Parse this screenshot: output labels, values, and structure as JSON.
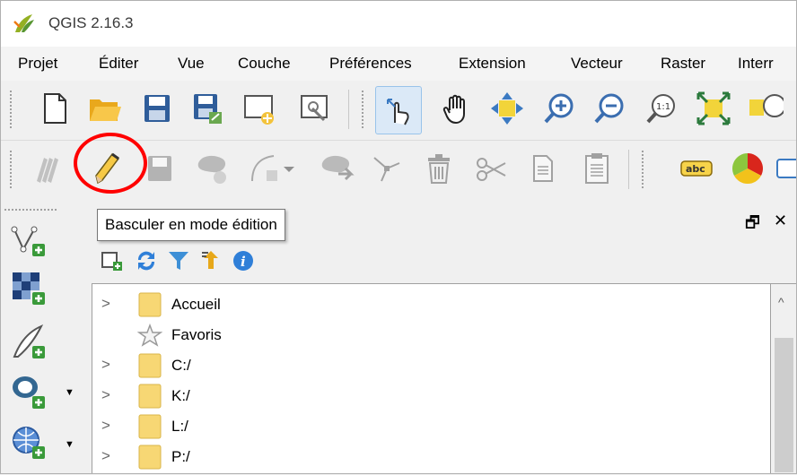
{
  "window": {
    "title": "QGIS 2.16.3",
    "logo_icon": "qgis-logo-icon"
  },
  "menu": [
    {
      "id": "projet",
      "label": "Projet"
    },
    {
      "id": "editer",
      "label": "Éditer"
    },
    {
      "id": "vue",
      "label": "Vue"
    },
    {
      "id": "couche",
      "label": "Couche"
    },
    {
      "id": "preferences",
      "label": "Préférences"
    },
    {
      "id": "extension",
      "label": "Extension"
    },
    {
      "id": "vecteur",
      "label": "Vecteur"
    },
    {
      "id": "raster",
      "label": "Raster"
    },
    {
      "id": "internet",
      "label": "Interr"
    }
  ],
  "toolbar_file": [
    "new-project-icon",
    "open-project-icon",
    "save-project-icon",
    "save-project-as-icon",
    "new-print-composer-icon",
    "composer-manager-icon"
  ],
  "toolbar_map": [
    "touch-zoom-icon",
    "pan-icon",
    "pan-to-selection-icon",
    "zoom-in-icon",
    "zoom-out-icon",
    "zoom-native-icon",
    "zoom-full-icon",
    "zoom-to-layer-icon"
  ],
  "toolbar_edit": [
    "current-edits-icon",
    "toggle-editing-icon",
    "save-edits-icon",
    "add-feature-icon",
    "add-curve-icon",
    "move-feature-icon",
    "node-tool-icon",
    "delete-selected-icon",
    "cut-features-icon",
    "copy-features-icon",
    "paste-features-icon"
  ],
  "toolbar_label": [
    "label-icon",
    "diagram-icon",
    "label-pin-icon"
  ],
  "tooltip": {
    "text": "Basculer en mode édition"
  },
  "left_toolbar": [
    "add-vector-layer-icon",
    "add-raster-layer-icon",
    "add-delimited-text-icon",
    "add-postgis-layer-icon",
    "add-wms-layer-icon"
  ],
  "browser": {
    "header_buttons": {
      "float": "🗗",
      "close": "✕"
    },
    "tools": [
      "add-layer-icon",
      "refresh-icon",
      "filter-icon",
      "collapse-all-icon",
      "properties-icon"
    ],
    "items": [
      {
        "label": "Accueil",
        "icon": "folder-icon",
        "expandable": true
      },
      {
        "label": "Favoris",
        "icon": "star-icon",
        "expandable": false
      },
      {
        "label": "C:/",
        "icon": "folder-icon",
        "expandable": true
      },
      {
        "label": "K:/",
        "icon": "folder-icon",
        "expandable": true
      },
      {
        "label": "L:/",
        "icon": "folder-icon",
        "expandable": true
      },
      {
        "label": "P:/",
        "icon": "folder-icon",
        "expandable": true
      }
    ]
  },
  "colors": {
    "highlight_circle": "#ff0000",
    "folder": "#f7d774"
  }
}
